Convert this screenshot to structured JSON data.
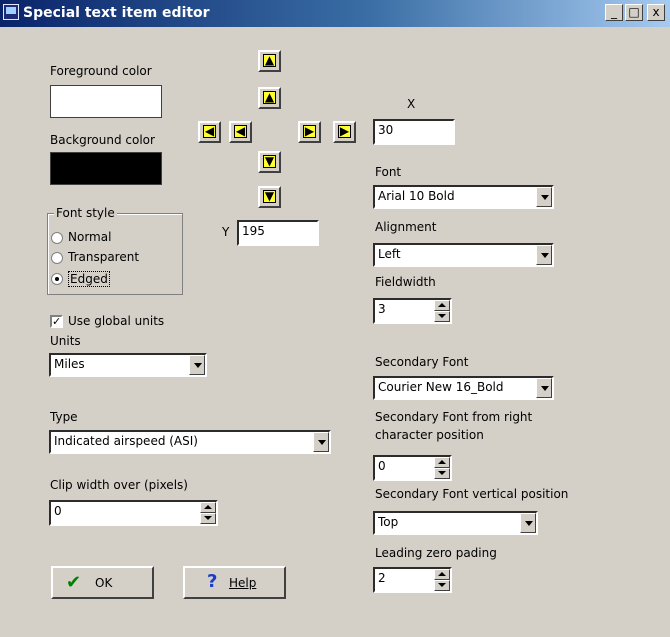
{
  "window": {
    "title": "Special text item editor",
    "minimize": "_",
    "maximize": "□",
    "close": "x",
    "icon": "app-icon"
  },
  "foreground": {
    "label": "Foreground color",
    "color": "#ffffff"
  },
  "background": {
    "label": "Background color",
    "color": "#000000"
  },
  "font_style": {
    "label": "Font style",
    "options": [
      "Normal",
      "Transparent",
      "Edged"
    ],
    "selected": "Edged"
  },
  "use_global_units": {
    "label": "Use global units",
    "checked": true,
    "mark": "✓"
  },
  "units": {
    "label": "Units",
    "value": "Miles"
  },
  "type": {
    "label": "Type",
    "value": "Indicated airspeed (ASI)"
  },
  "clip_width": {
    "label": "Clip width over (pixels)",
    "value": "0"
  },
  "x": {
    "label": "X",
    "value": "30"
  },
  "y": {
    "label": "Y",
    "value": "195"
  },
  "font": {
    "label": "Font",
    "value": "Arial 10 Bold"
  },
  "alignment": {
    "label": "Alignment",
    "value": "Left"
  },
  "fieldwidth": {
    "label": "Fieldwidth",
    "value": "3"
  },
  "secondary_font": {
    "label": "Secondary Font",
    "value": "Courier New 16_Bold"
  },
  "secondary_font_right": {
    "label_line1": "Secondary Font from right",
    "label_line2": "character position",
    "value": "0"
  },
  "secondary_font_vpos": {
    "label": "Secondary Font vertical position",
    "value": "Top"
  },
  "leading_zero": {
    "label": "Leading zero pading",
    "value": "2"
  },
  "buttons": {
    "ok": "OK",
    "ok_icon": "✔",
    "help": "Help",
    "help_icon": "?"
  },
  "hand_glyphs": {
    "up": "▲",
    "down": "▼",
    "left": "◀",
    "right": "▶"
  }
}
